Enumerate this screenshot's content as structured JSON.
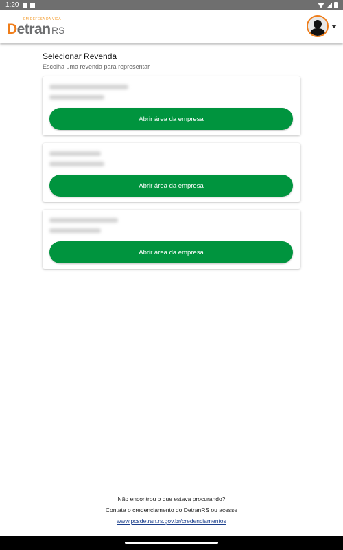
{
  "status_bar": {
    "time": "1:20"
  },
  "header": {
    "logo_tagline": "EM DEFESA DA VIDA",
    "logo_detran_first": "D",
    "logo_detran_rest": "etran",
    "logo_rs": "RS",
    "avatar_icon": "user-avatar-icon"
  },
  "page": {
    "title": "Selecionar Revenda",
    "subtitle": "Escolha uma revenda para representar"
  },
  "cards": [
    {
      "button_label": "Abrir área da empresa"
    },
    {
      "button_label": "Abrir área da empresa"
    },
    {
      "button_label": "Abrir área da empresa"
    }
  ],
  "footer": {
    "line1": "Não encontrou o que estava procurando?",
    "line2": "Contate o credenciamento do DetranRS ou acesse",
    "link": "www.pcsdetran.rs.gov.br/credenciamentos"
  },
  "colors": {
    "accent_green": "#00943e",
    "brand_orange": "#ef7d1a",
    "brand_gray": "#6d6e70",
    "link_blue": "#1a3e8c"
  }
}
